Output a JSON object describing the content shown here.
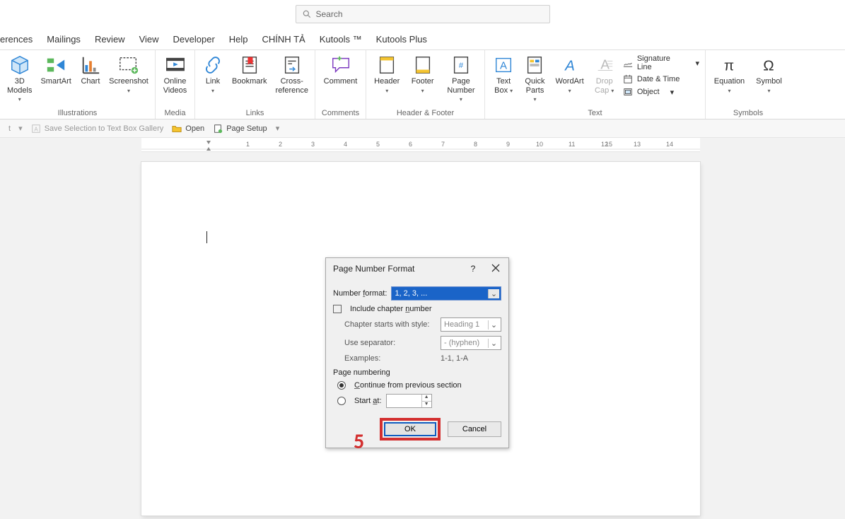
{
  "search_placeholder": "Search",
  "tabs": [
    "erences",
    "Mailings",
    "Review",
    "View",
    "Developer",
    "Help",
    "CHÍNH TẢ",
    "Kutools ™",
    "Kutools Plus"
  ],
  "ribbon": {
    "illustrations": {
      "label": "Illustrations",
      "models3d": "3D\nModels",
      "smartart": "SmartArt",
      "chart": "Chart",
      "screenshot": "Screenshot"
    },
    "media": {
      "label": "Media",
      "onlinevideos": "Online\nVideos"
    },
    "links": {
      "label": "Links",
      "link": "Link",
      "bookmark": "Bookmark",
      "crossref": "Cross-\nreference"
    },
    "comments": {
      "label": "Comments",
      "comment": "Comment"
    },
    "headerfooter": {
      "label": "Header & Footer",
      "header": "Header",
      "footer": "Footer",
      "pagenum": "Page\nNumber"
    },
    "text": {
      "label": "Text",
      "textbox": "Text\nBox",
      "quickparts": "Quick\nParts",
      "wordart": "WordArt",
      "dropcap": "Drop\nCap",
      "sigline": "Signature Line",
      "datetime": "Date & Time",
      "object": "Object"
    },
    "symbols": {
      "label": "Symbols",
      "equation": "Equation",
      "symbol": "Symbol"
    }
  },
  "qat": {
    "saveSel": "Save Selection to Text Box Gallery",
    "open": "Open",
    "pagesetup": "Page Setup"
  },
  "dialog": {
    "title": "Page Number Format",
    "numfmt_label": "Number format:",
    "numfmt_value": "1, 2, 3, ...",
    "include_chapter": "Include chapter number",
    "chapter_starts": "Chapter starts with style:",
    "chapter_style_value": "Heading 1",
    "use_sep": "Use separator:",
    "sep_value": "-   (hyphen)",
    "examples_label": "Examples:",
    "examples_value": "1-1, 1-A",
    "pagenum_caption": "Page numbering",
    "continue": "Continue from previous section",
    "start_at": "Start at:",
    "ok": "OK",
    "cancel": "Cancel"
  },
  "annotation_step": "5"
}
